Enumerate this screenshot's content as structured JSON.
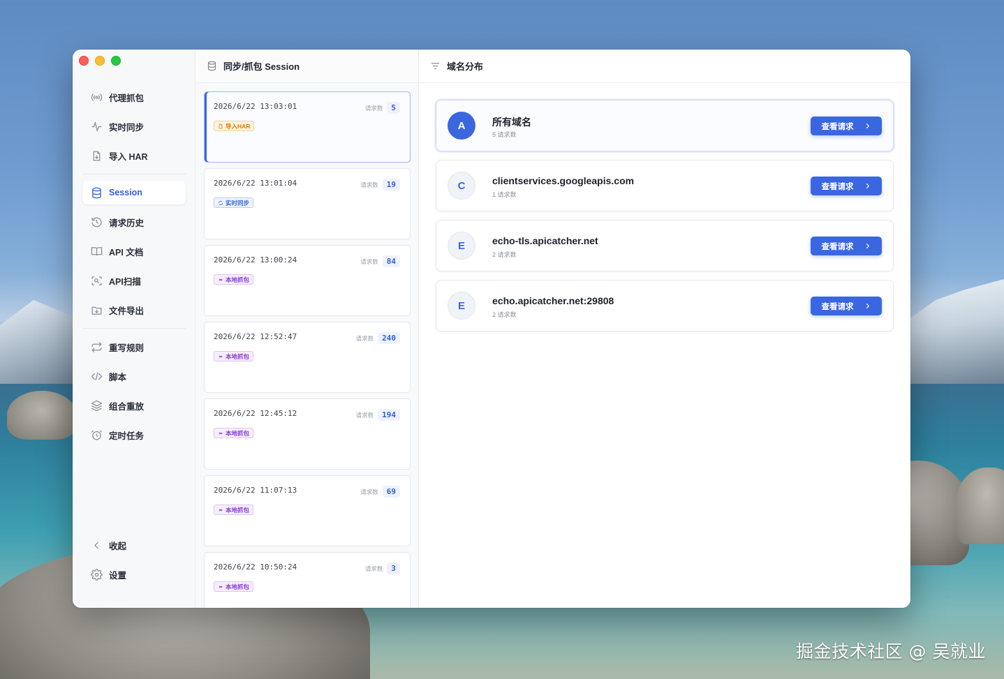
{
  "sidebar": {
    "top_items": [
      {
        "label": "代理抓包",
        "icon": "broadcast-icon"
      },
      {
        "label": "实时同步",
        "icon": "activity-icon"
      },
      {
        "label": "导入 HAR",
        "icon": "file-import-icon"
      }
    ],
    "mid_items": [
      {
        "label": "Session",
        "icon": "database-icon",
        "active": true
      },
      {
        "label": "请求历史",
        "icon": "history-icon"
      },
      {
        "label": "API 文档",
        "icon": "book-icon"
      },
      {
        "label": "API扫描",
        "icon": "scan-icon"
      },
      {
        "label": "文件导出",
        "icon": "export-icon"
      }
    ],
    "tool_items": [
      {
        "label": "重写规则",
        "icon": "repeat-icon"
      },
      {
        "label": "脚本",
        "icon": "code-icon"
      },
      {
        "label": "组合重放",
        "icon": "layers-icon"
      },
      {
        "label": "定时任务",
        "icon": "alarm-icon"
      }
    ],
    "bottom_items": [
      {
        "label": "收起",
        "icon": "chevron-left-icon"
      },
      {
        "label": "设置",
        "icon": "gear-icon"
      }
    ]
  },
  "session_panel": {
    "title": "同步/抓包 Session",
    "count_label": "请求数",
    "sessions": [
      {
        "time": "2026/6/22 13:03:01",
        "count": "5",
        "badge": "导入HAR",
        "badge_type": "orange",
        "active": true
      },
      {
        "time": "2026/6/22 13:01:04",
        "count": "19",
        "badge": "实时同步",
        "badge_type": "blue"
      },
      {
        "time": "2026/6/22 13:00:24",
        "count": "84",
        "badge": "本地抓包",
        "badge_type": "purple"
      },
      {
        "time": "2026/6/22 12:52:47",
        "count": "240",
        "badge": "本地抓包",
        "badge_type": "purple"
      },
      {
        "time": "2026/6/22 12:45:12",
        "count": "194",
        "badge": "本地抓包",
        "badge_type": "purple"
      },
      {
        "time": "2026/6/22 11:07:13",
        "count": "69",
        "badge": "本地抓包",
        "badge_type": "purple"
      },
      {
        "time": "2026/6/22 10:50:24",
        "count": "3",
        "badge": "本地抓包",
        "badge_type": "purple"
      }
    ]
  },
  "domain_panel": {
    "title": "域名分布",
    "button_label": "查看请求",
    "domains": [
      {
        "letter": "A",
        "name": "所有域名",
        "sub": "5 请求数",
        "primary": true
      },
      {
        "letter": "C",
        "name": "clientservices.googleapis.com",
        "sub": "1 请求数"
      },
      {
        "letter": "E",
        "name": "echo-tls.apicatcher.net",
        "sub": "2 请求数"
      },
      {
        "letter": "E",
        "name": "echo.apicatcher.net:29808",
        "sub": "2 请求数"
      }
    ]
  },
  "watermark": "掘金技术社区 @ 吴就业",
  "colors": {
    "accent": "#3a66e0",
    "badge_orange": "#d97b0a",
    "badge_blue": "#3b6ad6",
    "badge_purple": "#8a3fd1"
  }
}
